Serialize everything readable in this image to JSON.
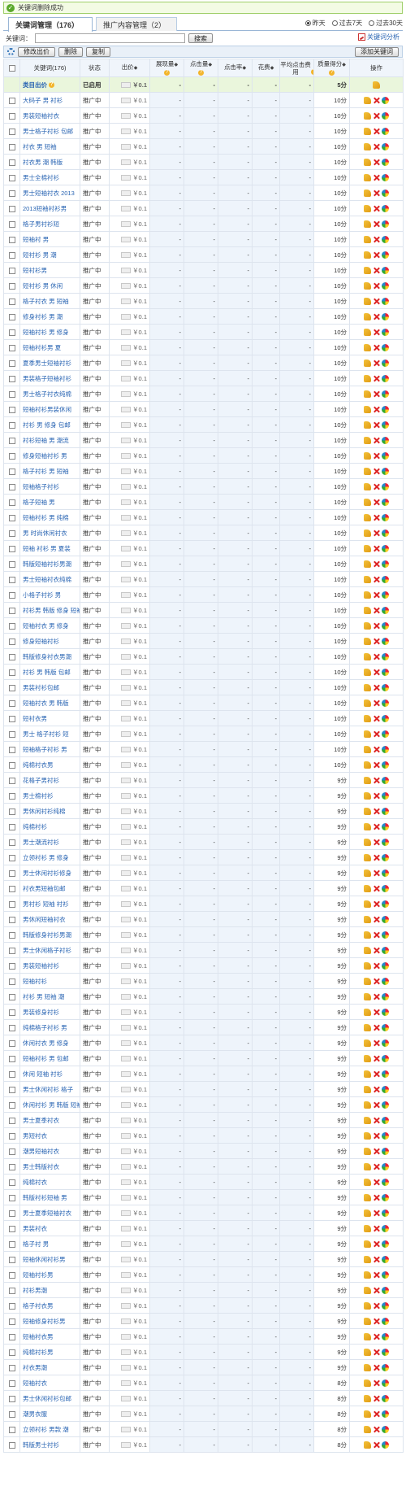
{
  "notice": {
    "text": "关键词删除成功"
  },
  "tabs": [
    {
      "label": "关键词管理（176）",
      "active": true
    },
    {
      "label": "推广内容管理（2）",
      "active": false
    }
  ],
  "date_ranges": [
    {
      "label": "昨天",
      "selected": true
    },
    {
      "label": "过去7天",
      "selected": false
    },
    {
      "label": "过去30天",
      "selected": false
    }
  ],
  "search": {
    "label": "关键词：",
    "value": "",
    "button": "搜索"
  },
  "analysis_link": "关键词分析",
  "toolbar": {
    "modify_bid": "修改出价",
    "delete": "删除",
    "copy": "复制",
    "add_keyword": "添加关键词"
  },
  "columns": [
    "关键词(176)",
    "状态",
    "出价",
    "展现量",
    "点击量",
    "点击率",
    "花费",
    "平均点击费用",
    "质量得分",
    "操作"
  ],
  "summary": {
    "name": "类目出价",
    "status": "已启用",
    "bid": "￥0.1",
    "metric": "-",
    "score": "5分"
  },
  "status_text": "推广中",
  "bid_text": "￥0.1",
  "metric_dash": "-",
  "keywords": [
    {
      "name": "大码子 男 衬衫",
      "score": "10分"
    },
    {
      "name": "男装短袖衬衣",
      "score": "10分"
    },
    {
      "name": "男士格子衬衫 包邮",
      "score": "10分"
    },
    {
      "name": "衬衣 男 短袖",
      "score": "10分"
    },
    {
      "name": "衬衣男 潮 韩版",
      "score": "10分"
    },
    {
      "name": "男士全棉衬衫",
      "score": "10分"
    },
    {
      "name": "男士短袖衬衣 2013",
      "score": "10分"
    },
    {
      "name": "2013短袖衬衫男",
      "score": "10分"
    },
    {
      "name": "格子男衬衫短",
      "score": "10分"
    },
    {
      "name": "短袖衬 男",
      "score": "10分"
    },
    {
      "name": "短衬衫 男 潮",
      "score": "10分"
    },
    {
      "name": "短衬衫男",
      "score": "10分"
    },
    {
      "name": "短衬衫 男 休闲",
      "score": "10分"
    },
    {
      "name": "格子衬衣 男 短袖",
      "score": "10分"
    },
    {
      "name": "修身衬衫 男 潮",
      "score": "10分"
    },
    {
      "name": "短袖衬衫 男 修身",
      "score": "10分"
    },
    {
      "name": "短袖衬衫男 夏",
      "score": "10分"
    },
    {
      "name": "夏季男士短袖衬衫",
      "score": "10分"
    },
    {
      "name": "男装格子短袖衬衫",
      "score": "10分"
    },
    {
      "name": "男士格子衬衣纯棉",
      "score": "10分"
    },
    {
      "name": "短袖衬衫男装休闲",
      "score": "10分"
    },
    {
      "name": "衬衫 男 修身 包邮",
      "score": "10分"
    },
    {
      "name": "衬衫短袖 男 潮流",
      "score": "10分"
    },
    {
      "name": "修身短袖衬衫 男",
      "score": "10分"
    },
    {
      "name": "格子衬衫 男 短袖",
      "score": "10分"
    },
    {
      "name": "短袖格子衬衫",
      "score": "10分"
    },
    {
      "name": "格子短袖 男",
      "score": "10分"
    },
    {
      "name": "短袖衬衫 男 纯棉",
      "score": "10分"
    },
    {
      "name": "男 时尚休闲衬衣",
      "score": "10分"
    },
    {
      "name": "短袖 衬衫 男 夏装",
      "score": "10分"
    },
    {
      "name": "韩版短袖衬衫男潮",
      "score": "10分"
    },
    {
      "name": "男士短袖衬衣纯棉",
      "score": "10分"
    },
    {
      "name": "小格子衬衫 男",
      "score": "10分"
    },
    {
      "name": "衬衫男 韩版 修身 短袖",
      "score": "10分"
    },
    {
      "name": "短袖衬衣 男 修身",
      "score": "10分"
    },
    {
      "name": "修身短袖衬衫",
      "score": "10分"
    },
    {
      "name": "韩版修身衬衣男潮",
      "score": "10分"
    },
    {
      "name": "衬衫 男 韩版 包邮",
      "score": "10分"
    },
    {
      "name": "男装衬衫包邮",
      "score": "10分"
    },
    {
      "name": "短袖衬衣 男 韩版",
      "score": "10分"
    },
    {
      "name": "短衬衣男",
      "score": "10分"
    },
    {
      "name": "男士 格子衬衫 短",
      "score": "10分"
    },
    {
      "name": "短袖格子衬衫 男",
      "score": "10分"
    },
    {
      "name": "纯棉衬衣男",
      "score": "10分"
    },
    {
      "name": "花格子男衬衫",
      "score": "9分"
    },
    {
      "name": "男士棉衬衫",
      "score": "9分"
    },
    {
      "name": "男休闲衬衫纯棉",
      "score": "9分"
    },
    {
      "name": "纯棉衬衫",
      "score": "9分"
    },
    {
      "name": "男士潮流衬衫",
      "score": "9分"
    },
    {
      "name": "立领衬衫 男 修身",
      "score": "9分"
    },
    {
      "name": "男士休闲衬衫修身",
      "score": "9分"
    },
    {
      "name": "衬衣男短袖包邮",
      "score": "9分"
    },
    {
      "name": "男衬衫 短袖 衬衫",
      "score": "9分"
    },
    {
      "name": "男休闲短袖衬衣",
      "score": "9分"
    },
    {
      "name": "韩版修身衬衫男潮",
      "score": "9分"
    },
    {
      "name": "男士休闲格子衬衫",
      "score": "9分"
    },
    {
      "name": "男装短袖衬衫",
      "score": "9分"
    },
    {
      "name": "短袖衬衫",
      "score": "9分"
    },
    {
      "name": "衬衫 男 短袖 潮",
      "score": "9分"
    },
    {
      "name": "男装修身衬衫",
      "score": "9分"
    },
    {
      "name": "纯棉格子衬衫 男",
      "score": "9分"
    },
    {
      "name": "休闲衬衣 男 修身",
      "score": "9分"
    },
    {
      "name": "短袖衬衫 男 包邮",
      "score": "9分"
    },
    {
      "name": "休闲 短袖 衬衫",
      "score": "9分"
    },
    {
      "name": "男士休闲衬衫 格子",
      "score": "9分"
    },
    {
      "name": "休闲衬衫 男 韩版 短袖",
      "score": "9分"
    },
    {
      "name": "男士夏季衬衣",
      "score": "9分"
    },
    {
      "name": "男短衬衣",
      "score": "9分"
    },
    {
      "name": "潮男短袖衬衣",
      "score": "9分"
    },
    {
      "name": "男士韩版衬衣",
      "score": "9分"
    },
    {
      "name": "纯棉衬衣",
      "score": "9分"
    },
    {
      "name": "韩版衬衫短袖 男",
      "score": "9分"
    },
    {
      "name": "男士夏季短袖衬衣",
      "score": "9分"
    },
    {
      "name": "男装衬衣",
      "score": "9分"
    },
    {
      "name": "格子衬 男",
      "score": "9分"
    },
    {
      "name": "短袖休闲衬衫男",
      "score": "9分"
    },
    {
      "name": "短袖衬衫男",
      "score": "9分"
    },
    {
      "name": "衬衫男潮",
      "score": "9分"
    },
    {
      "name": "格子衬衣男",
      "score": "9分"
    },
    {
      "name": "短袖修身衬衫男",
      "score": "9分"
    },
    {
      "name": "短袖衬衣男",
      "score": "9分"
    },
    {
      "name": "纯棉衬衫男",
      "score": "9分"
    },
    {
      "name": "衬衣男潮",
      "score": "9分"
    },
    {
      "name": "短袖衬衣",
      "score": "8分"
    },
    {
      "name": "男士休闲衬衫包邮",
      "score": "8分"
    },
    {
      "name": "潮男衣服",
      "score": "8分"
    },
    {
      "name": "立领衬衫 男款 潮",
      "score": "8分"
    },
    {
      "name": "韩版男士衬衫",
      "score": "8分"
    }
  ]
}
